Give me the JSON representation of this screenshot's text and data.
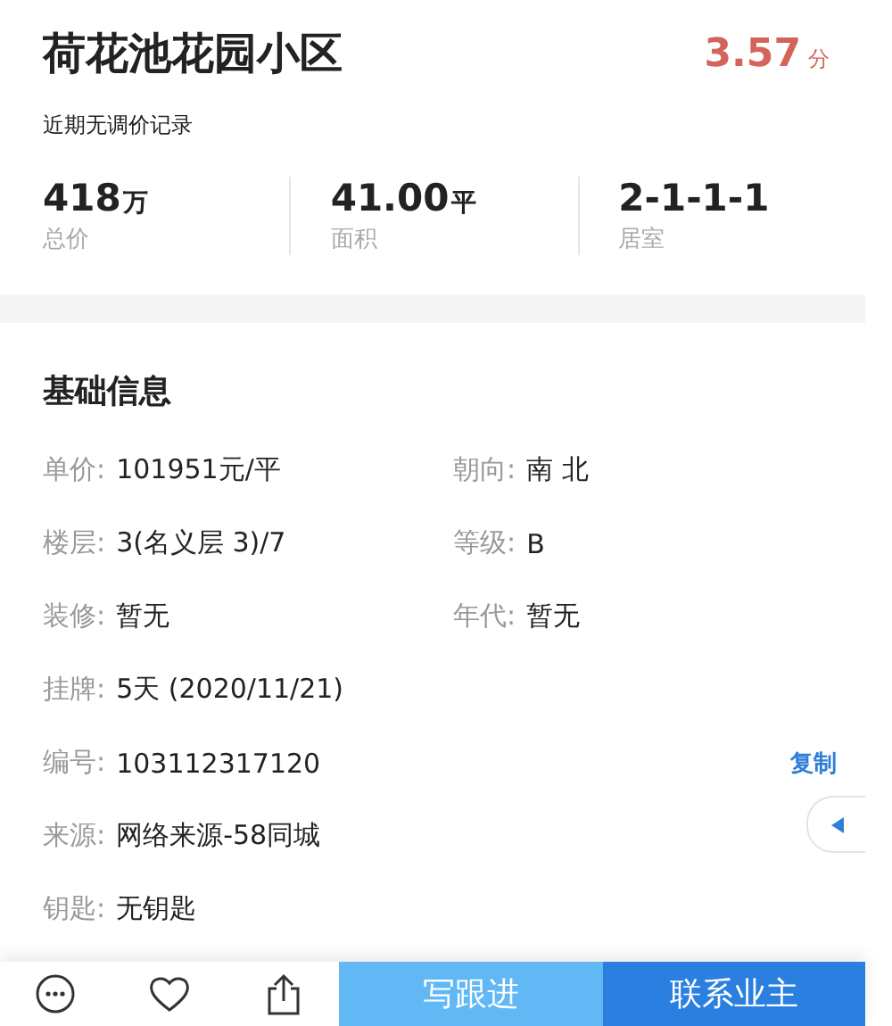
{
  "header": {
    "title": "荷花池花园小区",
    "score": "3.57",
    "score_unit": "分",
    "subtitle": "近期无调价记录"
  },
  "stats": [
    {
      "value": "418",
      "unit": "万",
      "label": "总价"
    },
    {
      "value": "41.00",
      "unit": "平",
      "label": "面积"
    },
    {
      "value": "2-1-1-1",
      "label": "居室"
    }
  ],
  "section": {
    "title": "基础信息"
  },
  "info_rows": [
    [
      {
        "label": "单价:",
        "value": "101951元/平"
      },
      {
        "label": "朝向:",
        "value": "南 北"
      }
    ],
    [
      {
        "label": "楼层:",
        "value": "3(名义层 3)/7"
      },
      {
        "label": "等级:",
        "value": "B"
      }
    ],
    [
      {
        "label": "装修:",
        "value": "暂无"
      },
      {
        "label": "年代:",
        "value": "暂无"
      }
    ],
    [
      {
        "label": "挂牌:",
        "value": "5天 (2020/11/21)"
      }
    ],
    [
      {
        "label": "编号:",
        "value": "103112317120",
        "action": "复制"
      }
    ],
    [
      {
        "label": "来源:",
        "value": "网络来源-58同城"
      }
    ],
    [
      {
        "label": "钥匙:",
        "value": "无钥匙"
      }
    ]
  ],
  "bottom_bar": {
    "buttons": [
      {
        "kind": "secondary",
        "label": "写跟进"
      },
      {
        "kind": "primary",
        "label": "联系业主"
      }
    ]
  }
}
